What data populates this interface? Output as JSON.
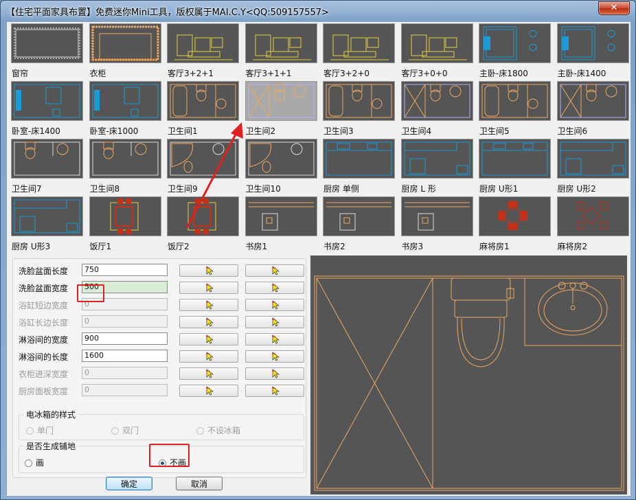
{
  "window": {
    "title": "【住宅平面家具布置】免费迷你Mini工具，版权属于MAI.C.Y<QQ:509157557>",
    "close_glyph": "✕"
  },
  "thumbnails": [
    {
      "label": "窗帘",
      "type": "curtain"
    },
    {
      "label": "衣柜",
      "type": "wardrobe"
    },
    {
      "label": "客厅3+2+1",
      "type": "living"
    },
    {
      "label": "客厅3+1+1",
      "type": "living"
    },
    {
      "label": "客厅3+2+0",
      "type": "living"
    },
    {
      "label": "客厅3+0+0",
      "type": "living"
    },
    {
      "label": "主卧-床1800",
      "type": "bedroom"
    },
    {
      "label": "主卧-床1400",
      "type": "bedroom"
    },
    {
      "label": "卧室-床1400",
      "type": "bedroom2"
    },
    {
      "label": "卧室-床1000",
      "type": "bedroom2"
    },
    {
      "label": "卫生间1",
      "type": "bath"
    },
    {
      "label": "卫生间2",
      "type": "bath-x",
      "selected": true
    },
    {
      "label": "卫生间3",
      "type": "bath"
    },
    {
      "label": "卫生间4",
      "type": "bath-x"
    },
    {
      "label": "卫生间5",
      "type": "bath"
    },
    {
      "label": "卫生间6",
      "type": "bath-x"
    },
    {
      "label": "卫生间7",
      "type": "bath-s"
    },
    {
      "label": "卫生间8",
      "type": "bath-s"
    },
    {
      "label": "卫生间9",
      "type": "bath-c"
    },
    {
      "label": "卫生间10",
      "type": "bath-c"
    },
    {
      "label": "厨房 单侧",
      "type": "kitchen"
    },
    {
      "label": "厨房 L 形",
      "type": "kitchen-l"
    },
    {
      "label": "厨房 U形1",
      "type": "kitchen"
    },
    {
      "label": "厨房 U形2",
      "type": "kitchen-l"
    },
    {
      "label": "厨房 U形3",
      "type": "kitchen-l"
    },
    {
      "label": "饭厅1",
      "type": "dining"
    },
    {
      "label": "饭厅2",
      "type": "dining"
    },
    {
      "label": "书房1",
      "type": "study"
    },
    {
      "label": "书房2",
      "type": "study"
    },
    {
      "label": "书房3",
      "type": "study"
    },
    {
      "label": "麻将房1",
      "type": "mahjong"
    },
    {
      "label": "麻将房2",
      "type": "mahjong2"
    }
  ],
  "fields": [
    {
      "label": "洗脸盆面长度",
      "value": "750",
      "enabled": true
    },
    {
      "label": "洗脸盆面宽度",
      "value": "500",
      "enabled": true,
      "active": true
    },
    {
      "label": "浴缸短边宽度",
      "value": "0",
      "enabled": false
    },
    {
      "label": "浴缸长边长度",
      "value": "0",
      "enabled": false
    },
    {
      "label": "淋浴间的宽度",
      "value": "900",
      "enabled": true
    },
    {
      "label": "淋浴间的长度",
      "value": "1600",
      "enabled": true
    },
    {
      "label": "衣柜进深宽度",
      "value": "0",
      "enabled": false
    },
    {
      "label": "厨房面板宽度",
      "value": "0",
      "enabled": false
    }
  ],
  "fridge_group": {
    "label": "电冰箱的样式",
    "options": [
      "单门",
      "双门",
      "不设冰箱"
    ]
  },
  "floor_group": {
    "label": "是否生成铺地",
    "options": [
      "画",
      "不画"
    ],
    "selected": "不画"
  },
  "buttons": {
    "ok": "确定",
    "cancel": "取消"
  },
  "colors": {
    "accent_red": "#e02020",
    "cad_line": "#f0a860",
    "cad_cyan": "#1a9ad6",
    "cad_yellow": "#e8d040",
    "cad_red": "#c83018"
  }
}
